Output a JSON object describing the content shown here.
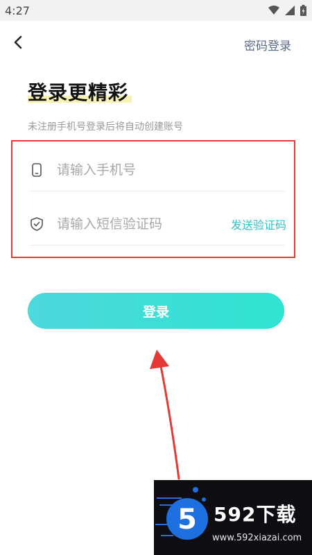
{
  "status_bar": {
    "time": "4:27"
  },
  "header": {
    "back_icon": "chevron-left-icon",
    "password_login_label": "密码登录"
  },
  "title": "登录更精彩",
  "subtitle": "未注册手机号登录后将自动创建账号",
  "form": {
    "phone": {
      "placeholder": "请输入手机号",
      "value": "",
      "icon": "phone-icon"
    },
    "code": {
      "placeholder": "请输入短信验证码",
      "value": "",
      "icon": "shield-check-icon",
      "send_label": "发送验证码"
    }
  },
  "login_button_label": "登录",
  "watermark": {
    "brand": "592下载",
    "url": "www.592xiazai.com"
  },
  "colors": {
    "accent": "#35c0c8",
    "button_start": "#4dd8dc",
    "button_end": "#2ee3d1",
    "annotation": "#e53935"
  }
}
